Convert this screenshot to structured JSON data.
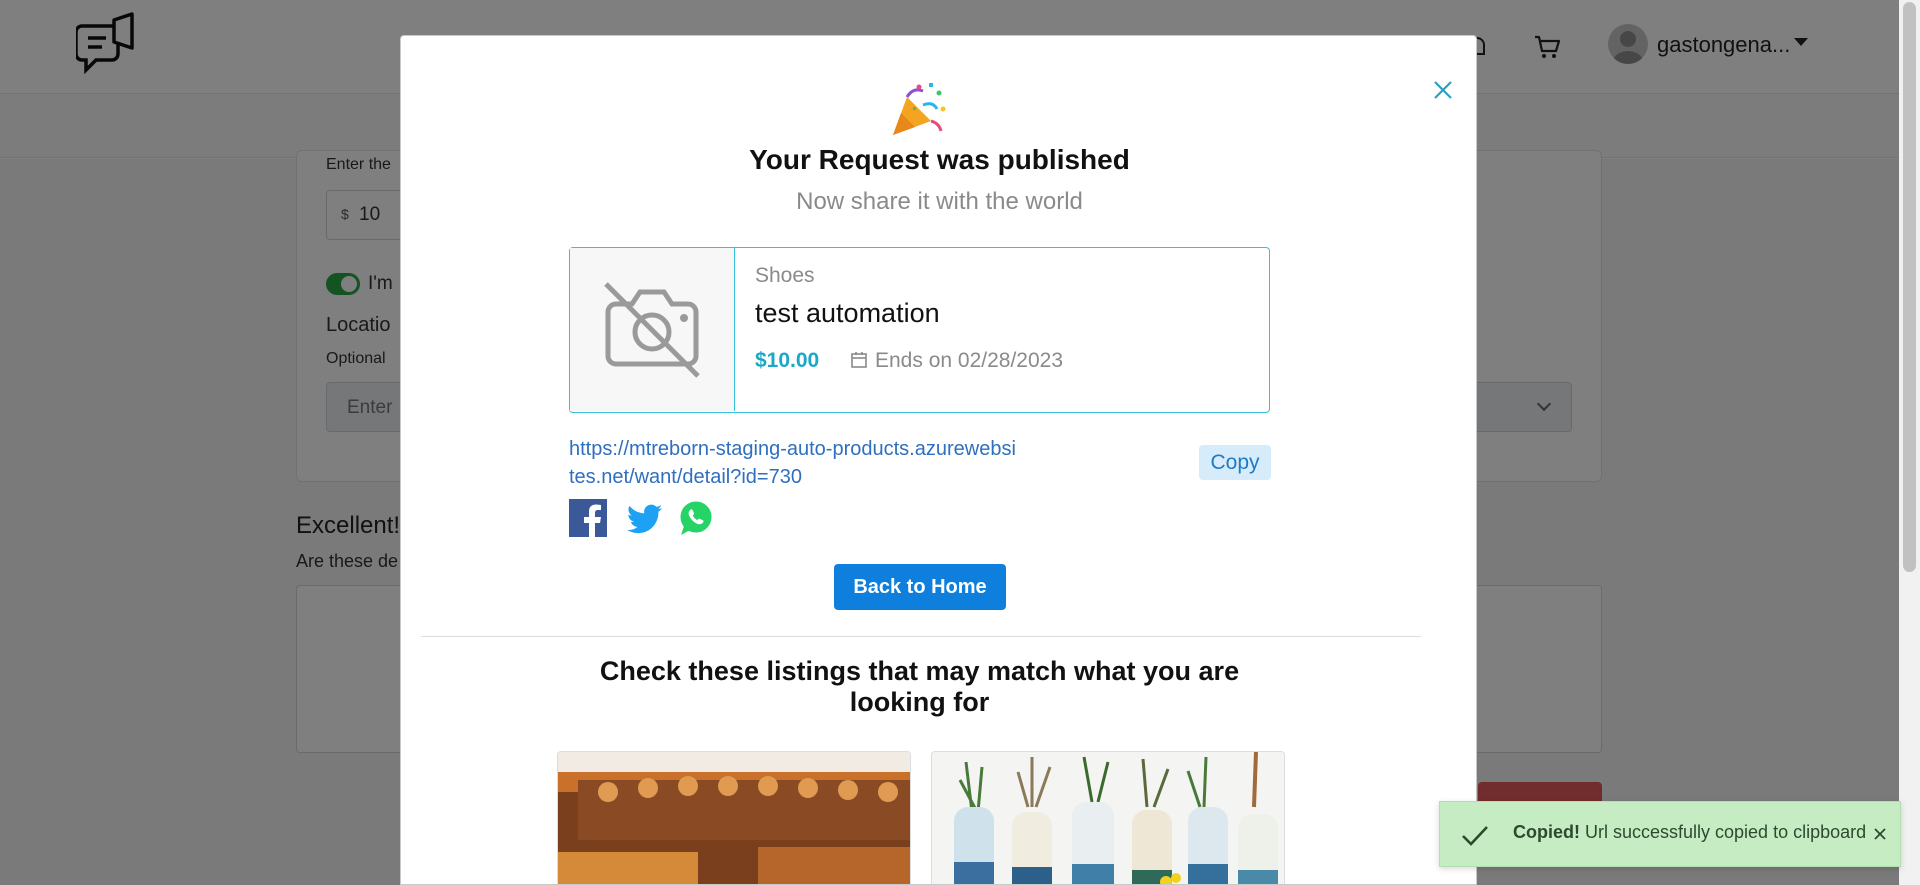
{
  "header": {
    "username": "gastongena..."
  },
  "form_background": {
    "price_label": "Enter the",
    "currency_symbol": "$",
    "price_value": "10",
    "toggle_label": "I'm",
    "location_label": "Locatio",
    "optional_label": "Optional",
    "location_placeholder": "Enter",
    "excellent_heading": "Excellent!",
    "details_question": "Are these de"
  },
  "modal": {
    "emoji": "🎉",
    "title": "Your Request was published",
    "subtitle": "Now share it with the world",
    "listing": {
      "category": "Shoes",
      "title": "test automation",
      "price": "$10.00",
      "ends": "Ends on 02/28/2023"
    },
    "share_url": "https://mtreborn-staging-auto-products.azurewebsites.net/want/detail?id=730",
    "copy_label": "Copy",
    "back_home_label": "Back to Home",
    "matches_heading": "Check these listings that may match what you are looking for"
  },
  "toast": {
    "strong": "Copied!",
    "message": " Url successfully copied to clipboard"
  },
  "colors": {
    "accent": "#34c1d9",
    "price": "#1aa8c6",
    "primary_button": "#0f7fde",
    "toast_bg": "#c6ecc3"
  }
}
